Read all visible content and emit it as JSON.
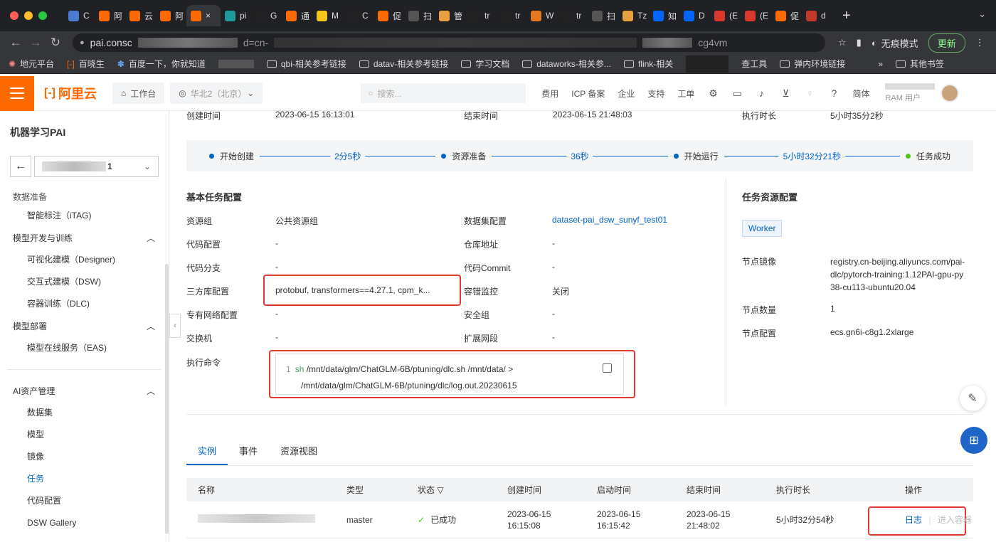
{
  "browser": {
    "tabs": [
      {
        "label": "C",
        "color": "#4a7bd1"
      },
      {
        "label": "阿",
        "color": "#ff6a00"
      },
      {
        "label": "云",
        "color": "#ff6a00"
      },
      {
        "label": "阿",
        "color": "#ff6a00"
      },
      {
        "label": "×",
        "color": "#ff6a00",
        "active": true
      },
      {
        "label": "pi",
        "color": "#1e9a9a"
      },
      {
        "label": "G",
        "color": "#222"
      },
      {
        "label": "通",
        "color": "#ff6a00"
      },
      {
        "label": "M",
        "color": "#f5c518"
      },
      {
        "label": "C",
        "color": "#222"
      },
      {
        "label": "促",
        "color": "#ff6a00"
      },
      {
        "label": "扫",
        "color": "#555"
      },
      {
        "label": "管",
        "color": "#e8a040"
      },
      {
        "label": "tr",
        "color": "#222"
      },
      {
        "label": "tr",
        "color": "#222"
      },
      {
        "label": "W",
        "color": "#e87722"
      },
      {
        "label": "tr",
        "color": "#222"
      },
      {
        "label": "扫",
        "color": "#555"
      },
      {
        "label": "Tz",
        "color": "#e8a040"
      },
      {
        "label": "知",
        "color": "#0066ff"
      },
      {
        "label": "D",
        "color": "#0066ff"
      },
      {
        "label": "(E",
        "color": "#d9392b"
      },
      {
        "label": "(E",
        "color": "#d9392b"
      },
      {
        "label": "促",
        "color": "#ff6a00"
      },
      {
        "label": "d",
        "color": "#c0392b"
      }
    ],
    "new_tab": "+",
    "tab_list": "⌄",
    "url_prefix": "pai.consc",
    "url_mid": "d=cn-",
    "url_end": "cg4vm",
    "incognito_label": "无痕模式",
    "update_label": "更新",
    "bookmarks": [
      "地元平台",
      "百晓生",
      "百度一下，你就知道",
      "qbi-相关参考链接",
      "datav-相关参考链接",
      "学习文档",
      "dataworks-相关参...",
      "flink-相关",
      "查工具",
      "弹内环境链接"
    ],
    "other_bookmarks": "其他书签"
  },
  "header": {
    "brand": "阿里云",
    "workbench": "工作台",
    "region": "华北2（北京）",
    "search_placeholder": "搜索...",
    "links": [
      "费用",
      "ICP 备案",
      "企业",
      "支持",
      "工单"
    ],
    "lang": "简体",
    "ram_user": "RAM 用户"
  },
  "sidebar": {
    "title": "机器学习PAI",
    "workspace_suffix": "1",
    "partial_group": "数据准备",
    "items_top": [
      {
        "label": "智能标注（iTAG)"
      }
    ],
    "groups": [
      {
        "label": "模型开发与训练",
        "items": [
          "可视化建模（Designer)",
          "交互式建模（DSW)",
          "容器训练（DLC)"
        ]
      },
      {
        "label": "模型部署",
        "items": [
          "模型在线服务（EAS)"
        ]
      }
    ],
    "asset_group": "AI资产管理",
    "asset_items": [
      "数据集",
      "模型",
      "镜像",
      "任务",
      "代码配置",
      "DSW Gallery"
    ],
    "active_item": "任务"
  },
  "job": {
    "created_label": "创建时间",
    "created_value": "2023-06-15 16:13:01",
    "ended_label": "结束时间",
    "ended_value": "2023-06-15 21:48:03",
    "duration_label": "执行时长",
    "duration_value": "5小时35分2秒",
    "timeline": {
      "steps": [
        "开始创建",
        "资源准备",
        "开始运行",
        "任务成功"
      ],
      "gaps": [
        "2分5秒",
        "36秒",
        "5小时32分21秒"
      ]
    },
    "basic_title": "基本任务配置",
    "resource_title": "任务资源配置",
    "fields_left": [
      {
        "k": "资源组",
        "v": "公共资源组"
      },
      {
        "k": "代码配置",
        "v": "-"
      },
      {
        "k": "代码分支",
        "v": "-"
      },
      {
        "k": "三方库配置",
        "v": "protobuf, transformers==4.27.1, cpm_k..."
      },
      {
        "k": "专有网络配置",
        "v": "-"
      },
      {
        "k": "交换机",
        "v": "-"
      }
    ],
    "fields_mid": [
      {
        "k": "数据集配置",
        "v": "dataset-pai_dsw_sunyf_test01"
      },
      {
        "k": "仓库地址",
        "v": "-"
      },
      {
        "k": "代码Commit",
        "v": "-"
      },
      {
        "k": "容错监控",
        "v": "关闭"
      },
      {
        "k": "安全组",
        "v": "-"
      },
      {
        "k": "扩展网段",
        "v": "-"
      }
    ],
    "command_label": "执行命令",
    "command": {
      "line_no": "1",
      "keyword": "sh",
      "line1": "/mnt/data/glm/ChatGLM-6B/ptuning/dlc.sh /mnt/data/ >",
      "line2": "/mnt/data/glm/ChatGLM-6B/ptuning/dlc/log.out.20230615"
    },
    "worker_tag": "Worker",
    "resource_fields": [
      {
        "k": "节点镜像",
        "v1": "registry.cn-beijing.aliyuncs.com/pai-",
        "v2": "dlc/pytorch-training:1.12PAI-gpu-py",
        "v3": "38-cu113-ubuntu20.04"
      },
      {
        "k": "节点数量",
        "v1": "1"
      },
      {
        "k": "节点配置",
        "v1": "ecs.gn6i-c8g1.2xlarge"
      }
    ]
  },
  "tabs": [
    "实例",
    "事件",
    "资源视图"
  ],
  "table": {
    "headers": [
      "名称",
      "类型",
      "状态",
      "创建时间",
      "启动时间",
      "结束时间",
      "执行时长",
      "操作"
    ],
    "row": {
      "type": "master",
      "status": "已成功",
      "created_d": "2023-06-15",
      "created_t": "16:15:08",
      "started_d": "2023-06-15",
      "started_t": "16:15:42",
      "ended_d": "2023-06-15",
      "ended_t": "21:48:02",
      "duration": "5小时32分54秒",
      "op_log": "日志",
      "op_enter": "进入容器"
    }
  },
  "colors": {
    "brand": "#ff6a00",
    "link": "#0064c8",
    "highlight": "#e03a2f",
    "success": "#52c41a"
  }
}
